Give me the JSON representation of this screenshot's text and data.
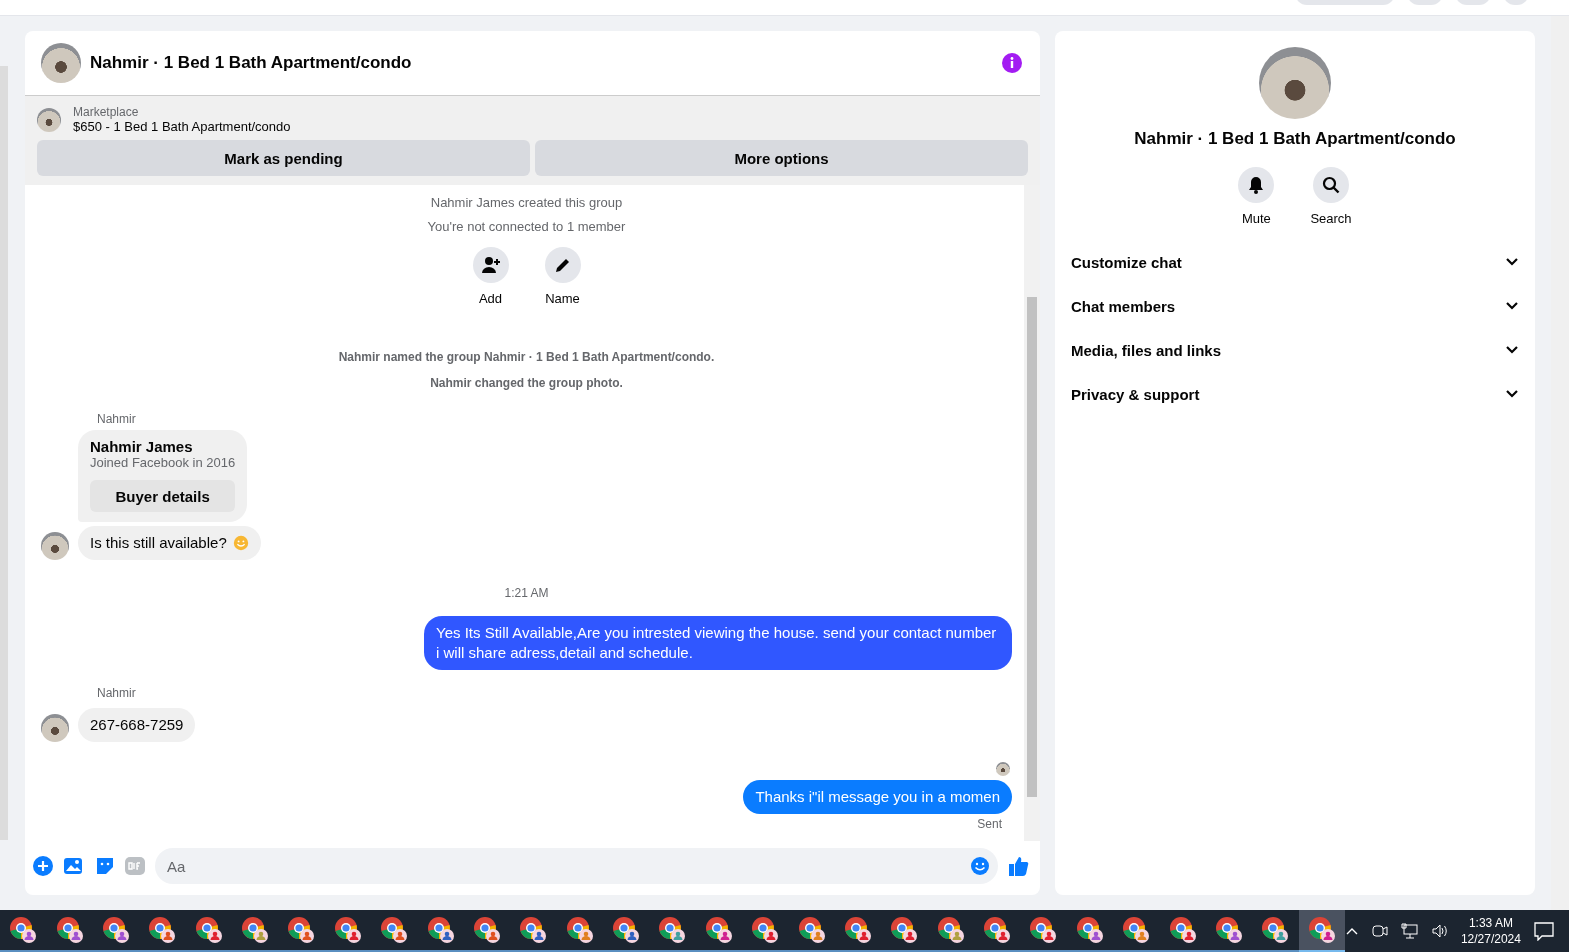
{
  "chat": {
    "title": "Nahmir · 1 Bed 1 Bath Apartment/condo",
    "listing": {
      "source": "Marketplace",
      "summary": "$650 - 1 Bed 1 Bath Apartment/condo"
    },
    "actions": [
      "Mark as pending",
      "More options"
    ],
    "thread": [
      {
        "kind": "note",
        "text": "Nahmir James created this group"
      },
      {
        "kind": "note",
        "text": "You're not connected to 1 member"
      },
      {
        "kind": "group_actions",
        "items": [
          {
            "kind": "add",
            "label": "Add"
          },
          {
            "kind": "name",
            "label": "Name"
          }
        ]
      },
      {
        "kind": "event",
        "text": "Nahmir named the group Nahmir · 1 Bed 1 Bath Apartment/condo."
      },
      {
        "kind": "event",
        "text": "Nahmir changed the group photo."
      },
      {
        "kind": "sender",
        "text": "Nahmir"
      },
      {
        "kind": "buyer_card",
        "name": "Nahmir James",
        "joined": "Joined Facebook in 2016",
        "button": "Buyer details"
      },
      {
        "kind": "incoming",
        "text": "Is this still available?",
        "emoji": true,
        "avatar": true
      },
      {
        "kind": "time",
        "text": "1:21 AM"
      },
      {
        "kind": "outgoing",
        "text": "Yes Its Still Available,Are you intrested viewing the house. send your contact number i will share adress,detail and schedule.",
        "color": "#3057ff"
      },
      {
        "kind": "sender",
        "text": "Nahmir"
      },
      {
        "kind": "incoming",
        "text": "267-668-7259",
        "emoji": false,
        "avatar": true
      },
      {
        "kind": "seen"
      },
      {
        "kind": "outgoing",
        "text": "Thanks i\"il message you in a momen",
        "color": "#0a7cff"
      },
      {
        "kind": "status",
        "text": "Sent"
      }
    ],
    "composer": {
      "placeholder": "Aa"
    }
  },
  "details": {
    "title": "Nahmir · 1 Bed 1 Bath Apartment/condo",
    "buttons": [
      {
        "kind": "mute",
        "label": "Mute"
      },
      {
        "kind": "search",
        "label": "Search"
      }
    ],
    "sections": [
      {
        "label": "Customize chat",
        "expanded": false
      },
      {
        "label": "Chat members",
        "expanded": false
      },
      {
        "label": "Media, files and links",
        "expanded": false
      },
      {
        "label": "Privacy & support",
        "expanded": false
      }
    ]
  },
  "taskbar": {
    "apps": [
      {
        "color": "#a050d0",
        "selected": false
      },
      {
        "color": "#a050d0",
        "selected": false
      },
      {
        "color": "#a050d0",
        "selected": false
      },
      {
        "color": "#e05020",
        "selected": false
      },
      {
        "color": "#e02030",
        "selected": false
      },
      {
        "color": "#b0a040",
        "selected": false
      },
      {
        "color": "#e05020",
        "selected": false
      },
      {
        "color": "#e02030",
        "selected": false
      },
      {
        "color": "#e05020",
        "selected": false
      },
      {
        "color": "#3060c0",
        "selected": false
      },
      {
        "color": "#e05020",
        "selected": false
      },
      {
        "color": "#3060c0",
        "selected": false
      },
      {
        "color": "#e08020",
        "selected": false
      },
      {
        "color": "#3060c0",
        "selected": false
      },
      {
        "color": "#40a0a0",
        "selected": false
      },
      {
        "color": "#d02090",
        "selected": false
      },
      {
        "color": "#e02030",
        "selected": false
      },
      {
        "color": "#e08020",
        "selected": false
      },
      {
        "color": "#e02030",
        "selected": false
      },
      {
        "color": "#e02030",
        "selected": false
      },
      {
        "color": "#b0a040",
        "selected": false
      },
      {
        "color": "#e02030",
        "selected": false
      },
      {
        "color": "#e02030",
        "selected": false
      },
      {
        "color": "#a050d0",
        "selected": false
      },
      {
        "color": "#e08020",
        "selected": false
      },
      {
        "color": "#e02030",
        "selected": false
      },
      {
        "color": "#a050d0",
        "selected": false
      },
      {
        "color": "#40a0a0",
        "selected": false
      },
      {
        "color": "#d02090",
        "selected": true
      }
    ],
    "time": "1:33 AM",
    "date": "12/27/2024"
  }
}
